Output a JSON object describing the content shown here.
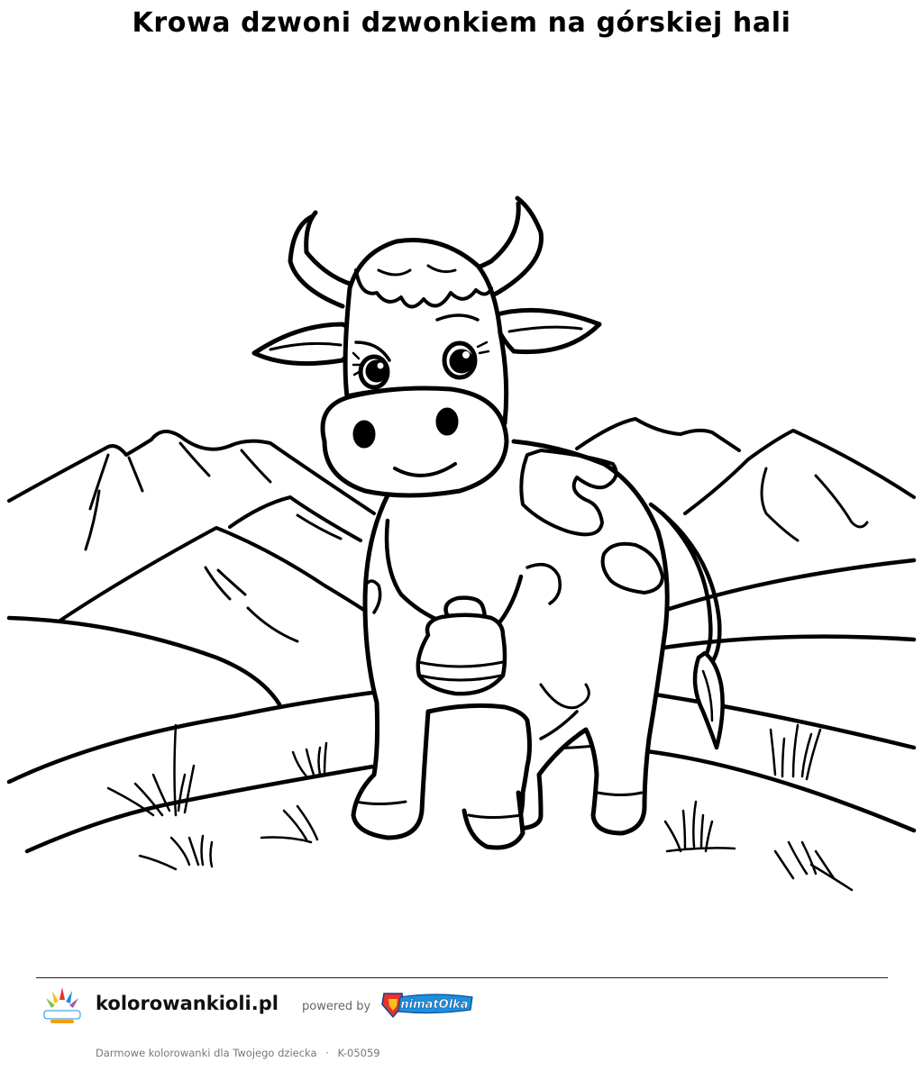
{
  "title": "Krowa dzwoni dzwonkiem na górskiej hali",
  "footer": {
    "site": "kolorowankioli.pl",
    "powered_by": "powered by",
    "logo_brand_text": "AnimatOlka",
    "logo_small_text": "KolorowankiOli",
    "tagline": "Darmowe kolorowanki dla Twojego dziecka",
    "separator": "·",
    "code": "K-05059"
  },
  "colors": {
    "text": "#000000",
    "muted": "#777777",
    "animat_blue": "#1c8fe0",
    "animat_red": "#e8322b",
    "animat_yellow": "#f7c21b"
  },
  "icons": [
    "kolorowankioli-logo-icon",
    "animatolka-logo-icon",
    "cow-coloring-illustration"
  ]
}
